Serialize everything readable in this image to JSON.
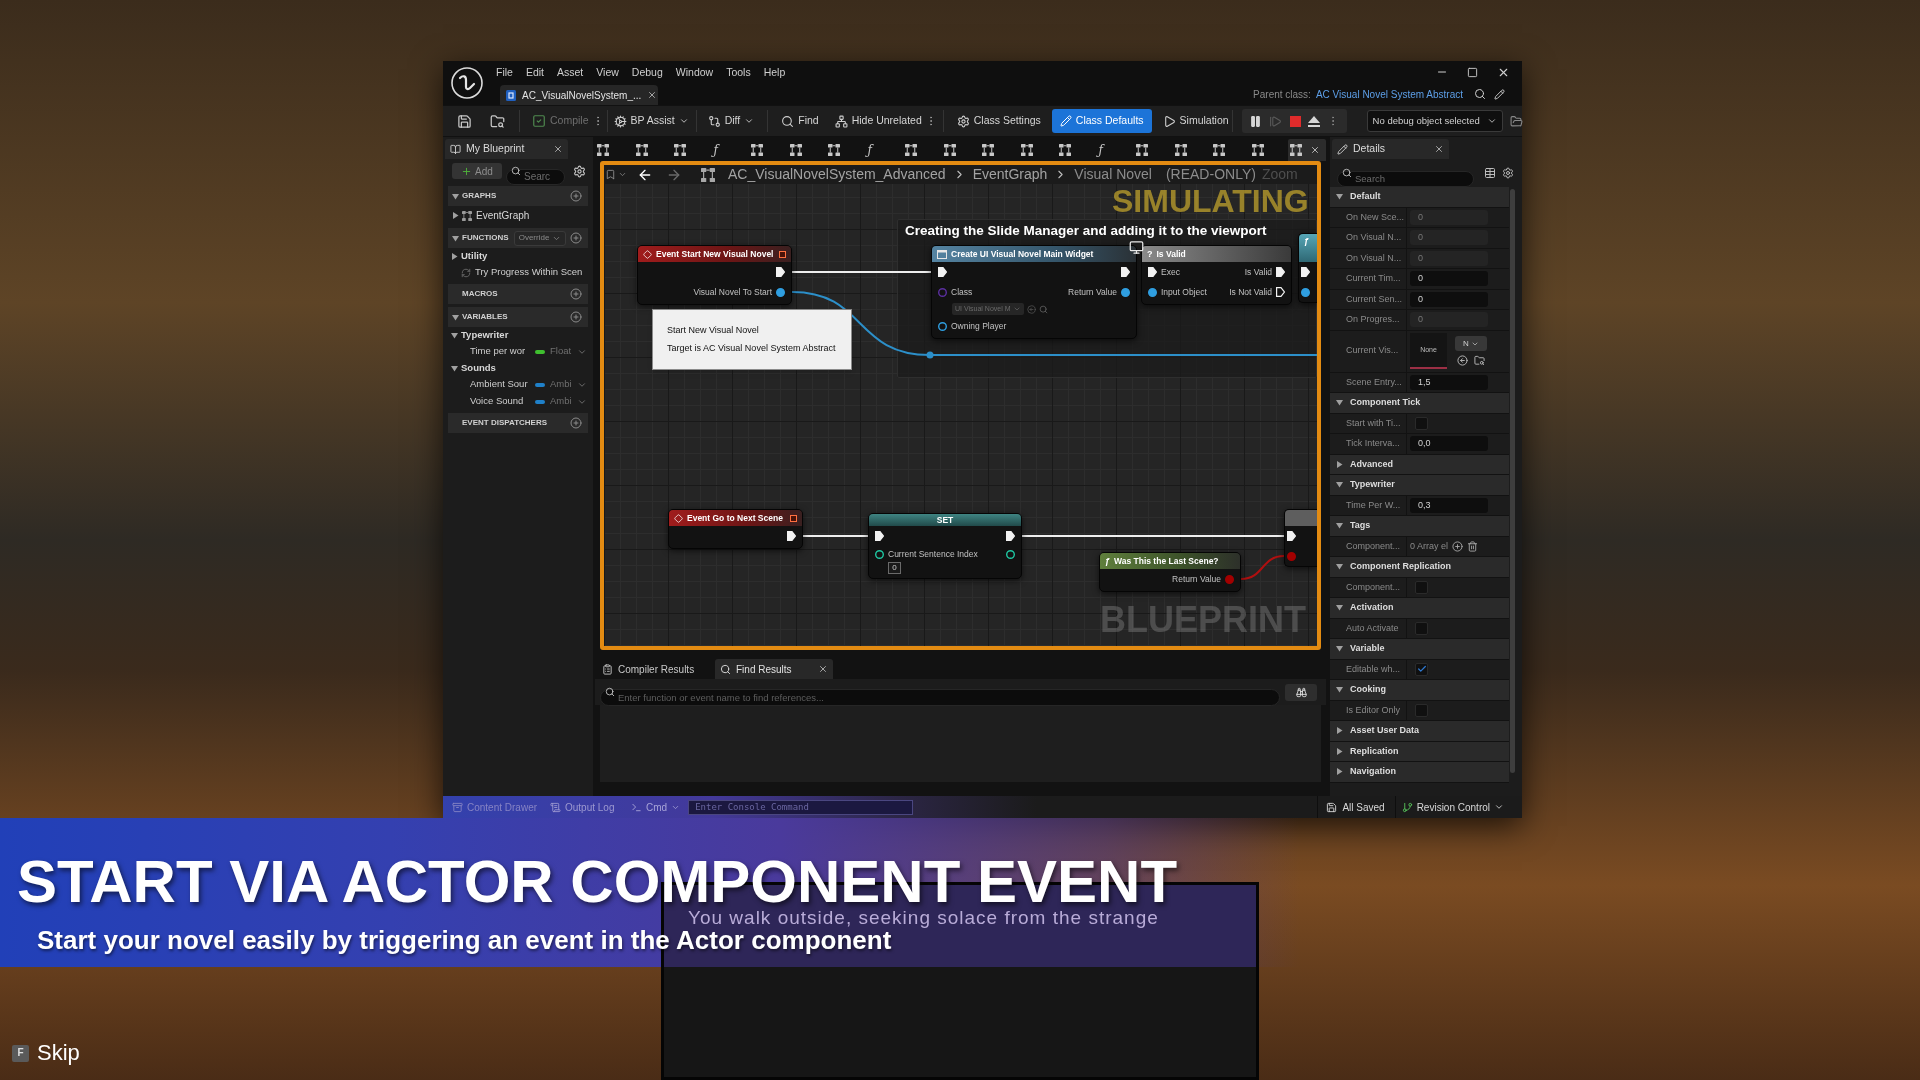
{
  "menu": [
    "File",
    "Edit",
    "Asset",
    "View",
    "Debug",
    "Window",
    "Tools",
    "Help"
  ],
  "document_tab": {
    "label": "AC_VisualNovelSystem_...",
    "selected": true
  },
  "parent_class": {
    "label": "Parent class:",
    "value": "AC Visual Novel System Abstract"
  },
  "toolbar": {
    "compile": {
      "label": "Compile",
      "disabled": true
    },
    "bp_assist": {
      "label": "BP Assist"
    },
    "diff": {
      "label": "Diff"
    },
    "find": {
      "label": "Find"
    },
    "hide_unrelated": {
      "label": "Hide Unrelated"
    },
    "class_settings": {
      "label": "Class Settings",
      "selected": false
    },
    "class_defaults": {
      "label": "Class Defaults",
      "selected": true
    },
    "simulation": {
      "label": "Simulation"
    },
    "debug_controls": [
      {
        "kind": "pause",
        "disabled": false
      },
      {
        "kind": "step",
        "disabled": true
      },
      {
        "kind": "stop",
        "disabled": false
      },
      {
        "kind": "eject",
        "disabled": false
      }
    ],
    "debug_object": {
      "value": "No debug object selected"
    }
  },
  "my_blueprint": {
    "title": "My Blueprint",
    "add_label": "Add",
    "search_placeholder": "Searc",
    "sections": [
      {
        "title": "GRAPHS",
        "expanded": true,
        "items": [
          {
            "kind": "graph",
            "label": "EventGraph",
            "expanded": false
          }
        ]
      },
      {
        "title": "FUNCTIONS",
        "expanded": true,
        "dropdown": "Override",
        "items": [
          {
            "kind": "category",
            "label": "Utility",
            "expanded": false
          },
          {
            "kind": "function",
            "label": "Try Progress Within Scen"
          }
        ]
      },
      {
        "title": "MACROS"
      },
      {
        "title": "VARIABLES",
        "expanded": true,
        "items": [
          {
            "kind": "category",
            "label": "Typewriter",
            "expanded": true,
            "children": [
              {
                "kind": "variable",
                "label": "Time per wor",
                "type": "Float",
                "color": "#3fbf2f"
              }
            ]
          },
          {
            "kind": "category",
            "label": "Sounds",
            "expanded": true,
            "children": [
              {
                "kind": "variable",
                "label": "Ambient Sour",
                "type": "Ambi",
                "color": "#1f80c8"
              },
              {
                "kind": "variable",
                "label": "Voice Sound",
                "type": "Ambi",
                "color": "#1f80c8"
              }
            ]
          }
        ]
      },
      {
        "title": "EVENT DISPATCHERS"
      }
    ]
  },
  "graph_tabs": [
    {
      "kind": "graph",
      "selected": false
    },
    {
      "kind": "graph",
      "selected": false
    },
    {
      "kind": "graph",
      "selected": false
    },
    {
      "kind": "function",
      "glyph": "ƒ",
      "selected": false
    },
    {
      "kind": "graph",
      "selected": false
    },
    {
      "kind": "graph",
      "selected": false
    },
    {
      "kind": "graph",
      "selected": false
    },
    {
      "kind": "function",
      "glyph": "ƒ",
      "selected": false
    },
    {
      "kind": "graph",
      "selected": false
    },
    {
      "kind": "graph",
      "selected": false
    },
    {
      "kind": "graph",
      "selected": false
    },
    {
      "kind": "graph",
      "selected": false
    },
    {
      "kind": "graph",
      "selected": false
    },
    {
      "kind": "function",
      "glyph": "ƒ",
      "selected": false
    },
    {
      "kind": "graph",
      "selected": false
    },
    {
      "kind": "graph",
      "selected": false
    },
    {
      "kind": "graph",
      "selected": false
    },
    {
      "kind": "graph",
      "selected": false
    },
    {
      "kind": "graph",
      "selected": true
    }
  ],
  "breadcrumb": {
    "path": [
      "AC_VisualNovelSystem_Advanced",
      "EventGraph",
      "Visual Novel"
    ],
    "mode": "(READ-ONLY)",
    "zoom": "Zoom"
  },
  "graph": {
    "overlay": "SIMULATING",
    "comment": "Creating the Slide Manager and adding it to the viewport",
    "nodes": [
      {
        "kind": "event",
        "title": "Event Start New Visual Novel",
        "rows": [
          {
            "out": {
              "kind": "exec",
              "connected": true
            }
          },
          {
            "out": {
              "kind": "data",
              "label": "Visual Novel To Start",
              "color": "#2f9ee0",
              "connected": true
            }
          }
        ]
      },
      {
        "kind": "function",
        "title": "Create UI Visual Novel Main Widget",
        "rows": [
          {
            "in": {
              "kind": "exec",
              "connected": true
            },
            "out": {
              "kind": "exec",
              "connected": true
            }
          },
          {
            "in": {
              "kind": "data",
              "label": "Class",
              "color": "#5b2fa0",
              "connected": false
            },
            "out": {
              "kind": "data",
              "label": "Return Value",
              "color": "#2f9ee0",
              "connected": true
            }
          },
          {
            "in": {
              "kind": "picker",
              "value": "UI Visual Novel M"
            }
          },
          {
            "in": {
              "kind": "data",
              "label": "Owning Player",
              "color": "#2f9ee0",
              "connected": false
            }
          }
        ]
      },
      {
        "kind": "macro",
        "glyph": "?",
        "title": "Is Valid",
        "rows": [
          {
            "in": {
              "kind": "exec",
              "label": "Exec",
              "connected": true
            },
            "out": {
              "kind": "exec",
              "label": "Is Valid",
              "connected": true
            }
          },
          {
            "in": {
              "kind": "data",
              "label": "Input Object",
              "color": "#2f9ee0",
              "connected": true
            },
            "out": {
              "kind": "exec",
              "label": "Is Not Valid",
              "connected": false
            }
          }
        ]
      },
      {
        "kind": "partial",
        "glyph": "ƒ",
        "rows": [
          {
            "in": {
              "kind": "exec",
              "connected": true
            }
          },
          {
            "in": {
              "kind": "data",
              "color": "#2f9ee0",
              "connected": true
            }
          }
        ]
      },
      {
        "kind": "event",
        "title": "Event Go to Next Scene",
        "rows": [
          {
            "out": {
              "kind": "exec",
              "connected": true
            }
          }
        ]
      },
      {
        "kind": "set",
        "title": "SET",
        "rows": [
          {
            "in": {
              "kind": "exec",
              "connected": true
            },
            "out": {
              "kind": "exec",
              "connected": true
            }
          },
          {
            "in": {
              "kind": "data",
              "label": "Current Sentence Index",
              "color": "#1fc7a2",
              "connected": false,
              "value": "0"
            },
            "out": {
              "kind": "data",
              "color": "#1fc7a2",
              "connected": false
            }
          }
        ]
      },
      {
        "kind": "partial",
        "rows": [
          {
            "in": {
              "kind": "exec",
              "connected": true
            }
          },
          {
            "in": {
              "kind": "data",
              "color": "#a30000",
              "connected": true
            }
          }
        ]
      },
      {
        "kind": "pure",
        "glyph": "ƒ",
        "title": "Was This the Last Scene?",
        "rows": [
          {
            "out": {
              "kind": "data",
              "label": "Return Value",
              "color": "#a30000",
              "connected": true
            }
          }
        ]
      }
    ],
    "tooltip": [
      "Start New Visual Novel",
      "Target is AC Visual Novel System Abstract"
    ],
    "watermark": "BLUEPRINT"
  },
  "find_panel": {
    "tabs": [
      {
        "kind": "compiler",
        "label": "Compiler Results",
        "selected": false
      },
      {
        "kind": "find",
        "label": "Find Results",
        "selected": true
      }
    ],
    "placeholder": "Enter function or event name to find references..."
  },
  "details": {
    "title": "Details",
    "search_placeholder": "Search",
    "sections": [
      {
        "title": "Default",
        "expanded": true,
        "rows": [
          {
            "kind": "number",
            "label": "On New Sce...",
            "value": "0",
            "disabled": true
          },
          {
            "kind": "number",
            "label": "On Visual N...",
            "value": "0",
            "disabled": true
          },
          {
            "kind": "number",
            "label": "On Visual N...",
            "value": "0",
            "disabled": true
          },
          {
            "kind": "number",
            "label": "Current Tim...",
            "value": "0",
            "disabled": false
          },
          {
            "kind": "number",
            "label": "Current Sen...",
            "value": "0",
            "disabled": false
          },
          {
            "kind": "number",
            "label": "On Progres...",
            "value": "0",
            "disabled": true
          },
          {
            "kind": "asset",
            "label": "Current Vis...",
            "value": "None",
            "dropdown": "N"
          },
          {
            "kind": "number",
            "label": "Scene Entry...",
            "value": "1,5",
            "disabled": false
          }
        ]
      },
      {
        "title": "Component Tick",
        "expanded": true,
        "rows": [
          {
            "kind": "checkbox",
            "label": "Start with Ti...",
            "checked": false
          },
          {
            "kind": "number",
            "label": "Tick Interva...",
            "value": "0,0",
            "disabled": false
          }
        ]
      },
      {
        "title": "Advanced",
        "expanded": false
      },
      {
        "title": "Typewriter",
        "expanded": true,
        "rows": [
          {
            "kind": "number",
            "label": "Time Per W...",
            "value": "0,3",
            "disabled": false
          }
        ]
      },
      {
        "title": "Tags",
        "expanded": true,
        "rows": [
          {
            "kind": "array",
            "label": "Component...",
            "value": "0 Array el"
          }
        ]
      },
      {
        "title": "Component Replication",
        "expanded": true,
        "rows": [
          {
            "kind": "checkbox",
            "label": "Component...",
            "checked": false
          }
        ]
      },
      {
        "title": "Activation",
        "expanded": true,
        "rows": [
          {
            "kind": "checkbox",
            "label": "Auto Activate",
            "checked": false
          }
        ]
      },
      {
        "title": "Variable",
        "expanded": true,
        "rows": [
          {
            "kind": "checkbox",
            "label": "Editable wh...",
            "checked": true
          }
        ]
      },
      {
        "title": "Cooking",
        "expanded": true,
        "rows": [
          {
            "kind": "checkbox",
            "label": "Is Editor Only",
            "checked": false
          }
        ]
      },
      {
        "title": "Asset User Data",
        "expanded": false
      },
      {
        "title": "Replication",
        "expanded": false
      },
      {
        "title": "Navigation",
        "expanded": false
      }
    ]
  },
  "status_bar": {
    "content_drawer": "Content Drawer",
    "output_log": "Output Log",
    "cmd": "Cmd",
    "console_placeholder": "Enter Console Command",
    "save_status": "All Saved",
    "revision_control": "Revision Control"
  },
  "banner": {
    "title": "START VIA ACTOR COMPONENT EVENT",
    "subtitle": "Start your novel easily by triggering an event in the Actor component"
  },
  "dialogue": {
    "text": "You walk outside, seeking solace from the strange"
  },
  "skip": {
    "key": "F",
    "label": "Skip"
  }
}
